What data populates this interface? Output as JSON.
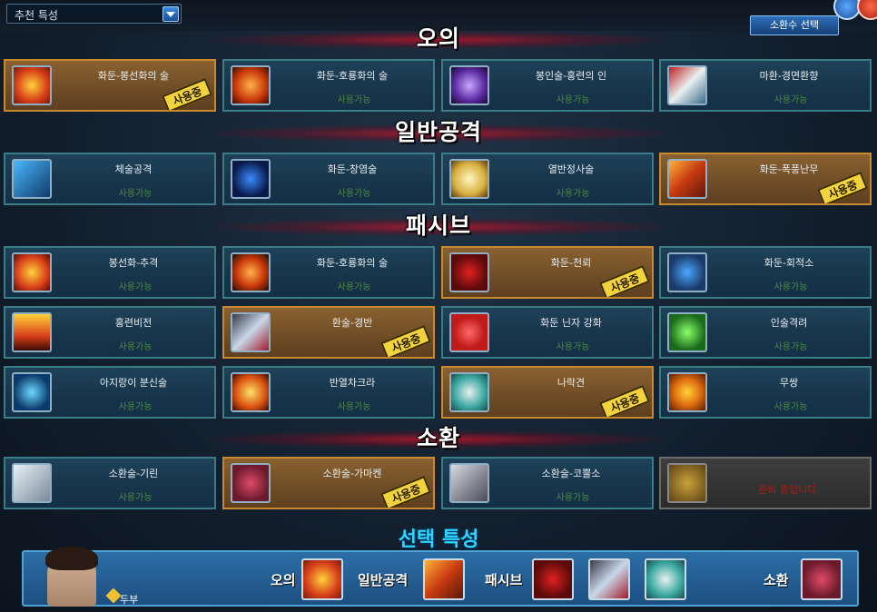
{
  "header": {
    "dropdown_value": "추천 특성",
    "summon_button": "소환수 선택"
  },
  "sections": {
    "ougi": "오의",
    "attack": "일반공격",
    "passive": "패시브",
    "summon": "소환"
  },
  "status": {
    "in_use": "사용중",
    "available": "사용가능",
    "locked": "준비 중입니다."
  },
  "ougi_cards": [
    {
      "name": "화둔-봉선화의 술",
      "active": true
    },
    {
      "name": "화둔-호룡화의 술",
      "active": false
    },
    {
      "name": "봉인술-홍련의 인",
      "active": false
    },
    {
      "name": "마환-경면환향",
      "active": false
    }
  ],
  "attack_cards": [
    {
      "name": "체술공격",
      "active": false
    },
    {
      "name": "화둔-창염술",
      "active": false
    },
    {
      "name": "열반정사술",
      "active": false
    },
    {
      "name": "화둔-폭풍난무",
      "active": true
    }
  ],
  "passive_cards": [
    {
      "name": "봉선화-추격",
      "active": false
    },
    {
      "name": "화둔-호룡화의 술",
      "active": false
    },
    {
      "name": "화둔-천뢰",
      "active": true
    },
    {
      "name": "화둔-회적소",
      "active": false
    },
    {
      "name": "홍련비전",
      "active": false
    },
    {
      "name": "환술-경반",
      "active": true
    },
    {
      "name": "화둔 닌자 강화",
      "active": false
    },
    {
      "name": "인술격려",
      "active": false
    },
    {
      "name": "아지랑이 분신술",
      "active": false
    },
    {
      "name": "반열차크라",
      "active": false
    },
    {
      "name": "나락견",
      "active": true
    },
    {
      "name": "무쌍",
      "active": false
    }
  ],
  "summon_cards": [
    {
      "name": "소환술-기린",
      "active": false
    },
    {
      "name": "소환술-가마켄",
      "active": true
    },
    {
      "name": "소환술-코뿔소",
      "active": false
    }
  ],
  "footer": {
    "title": "선택 특성",
    "rank": "두부",
    "label_ougi": "오의",
    "label_attack": "일반공격",
    "label_passive": "패시브",
    "label_summon": "소환"
  },
  "colors": {
    "active_border": "#c88a2c",
    "normal_border": "#3b7d86",
    "section_glow": "#c81428",
    "footer_title": "#2fd6ff"
  }
}
